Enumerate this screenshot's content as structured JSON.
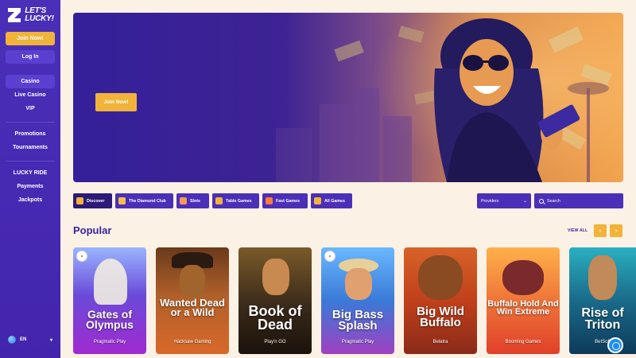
{
  "brand": {
    "name": "LET'S LUCKY!",
    "line1": "LET'S",
    "line2": "LUCKY!"
  },
  "sidebar": {
    "join_label": "Join Now!",
    "login_label": "Log In",
    "groups": [
      {
        "items": [
          {
            "label": "Casino",
            "active": true
          },
          {
            "label": "Live Casino"
          },
          {
            "label": "VIP"
          }
        ]
      },
      {
        "items": [
          {
            "label": "Promotions"
          },
          {
            "label": "Tournaments"
          }
        ]
      },
      {
        "items": [
          {
            "label": "LUCKY RIDE"
          },
          {
            "label": "Payments"
          },
          {
            "label": "Jackpots"
          }
        ]
      }
    ],
    "language": "EN"
  },
  "hero": {
    "cta_label": "Join Now!"
  },
  "filters": [
    {
      "label": "Discover",
      "icon": "discover-icon",
      "color": "#f1b33a",
      "active": true
    },
    {
      "label": "The Diamond Club",
      "icon": "diamond-icon",
      "color": "#f5c04a"
    },
    {
      "label": "Slots",
      "icon": "slots-icon",
      "color": "#f59a5a"
    },
    {
      "label": "Table Games",
      "icon": "table-games-icon",
      "color": "#f1b33a"
    },
    {
      "label": "Fast Games",
      "icon": "fast-games-icon",
      "color": "#ff7a3d"
    },
    {
      "label": "All Games",
      "icon": "all-games-icon",
      "color": "#f1b33a"
    }
  ],
  "providers": {
    "label": "Providers"
  },
  "search": {
    "placeholder": "Search"
  },
  "popular": {
    "title": "Popular",
    "view_all": "VIEW ALL",
    "prev_icon": "chevron-left-icon",
    "next_icon": "chevron-right-icon",
    "games": [
      {
        "title": "Gates of Olympus",
        "provider": "Pragmatic Play",
        "badge": true
      },
      {
        "title": "Wanted Dead or a Wild",
        "provider": "Hacksaw Gaming",
        "badge": false
      },
      {
        "title": "Book of Dead",
        "provider": "Play'n GO",
        "badge": false
      },
      {
        "title": "Big Bass Splash",
        "provider": "Pragmatic Play",
        "badge": true
      },
      {
        "title": "Big Wild Buffalo",
        "provider": "Belatra",
        "badge": false
      },
      {
        "title": "Buffalo Hold And Win Extreme",
        "provider": "Booming Games",
        "badge": false
      },
      {
        "title": "Rise of Triton",
        "provider": "BetSoft",
        "badge": false
      }
    ]
  },
  "colors": {
    "primary": "#4b2fb8",
    "accent": "#f1b33a",
    "background": "#fbf1e4"
  }
}
